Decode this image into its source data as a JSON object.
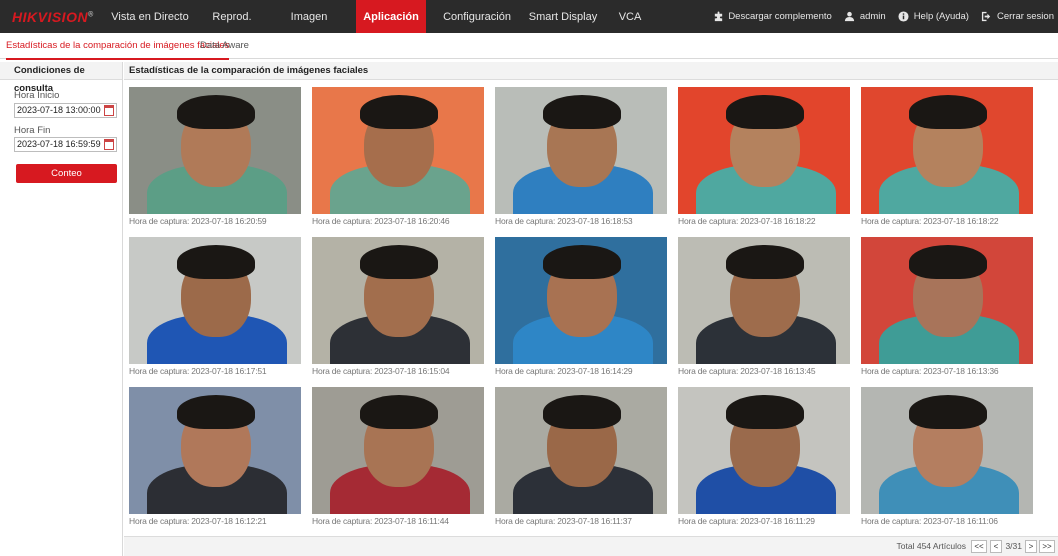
{
  "brand": {
    "logo": "HIKVISION",
    "reg": "®"
  },
  "nav": [
    {
      "label": "Vista en Directo"
    },
    {
      "label": "Reprod."
    },
    {
      "label": "Imagen"
    },
    {
      "label": "Aplicación",
      "active": true
    },
    {
      "label": "Configuración"
    },
    {
      "label": "Smart Display"
    },
    {
      "label": "VCA"
    }
  ],
  "topright": {
    "download": "Descargar complemento",
    "user": "admin",
    "help": "Help (Ayuda)",
    "logout": "Cerrar sesion"
  },
  "subtabs": [
    {
      "label": "Estadísticas de la comparación de imágenes faciales",
      "active": true
    },
    {
      "label": "Data Aware"
    }
  ],
  "query": {
    "title": "Condiciones de consulta",
    "start_label": "Hora Inicio",
    "start_value": "2023-07-18 13:00:00",
    "end_label": "Hora Fin",
    "end_value": "2023-07-18 16:59:59",
    "button": "Conteo"
  },
  "results": {
    "title": "Estadísticas de la comparación de imágenes faciales",
    "items": [
      {
        "caption": "Hora de captura: 2023-07-18 16:20:59",
        "palette": {
          "bg": "#8a8e86",
          "face": "#b07a58",
          "shirt": "#5c9e86"
        }
      },
      {
        "caption": "Hora de captura: 2023-07-18 16:20:46",
        "palette": {
          "bg": "#e8774a",
          "face": "#a66e4c",
          "shirt": "#6aa38d"
        }
      },
      {
        "caption": "Hora de captura: 2023-07-18 16:18:53",
        "palette": {
          "bg": "#b9bdb8",
          "face": "#a87654",
          "shirt": "#2f7fc0"
        }
      },
      {
        "caption": "Hora de captura: 2023-07-18 16:18:22",
        "palette": {
          "bg": "#e2452c",
          "face": "#b4825e",
          "shirt": "#4fa8a0"
        }
      },
      {
        "caption": "Hora de captura: 2023-07-18 16:18:22",
        "palette": {
          "bg": "#e0472e",
          "face": "#b4825e",
          "shirt": "#4fa8a0"
        }
      },
      {
        "caption": "Hora de captura: 2023-07-18 16:17:51",
        "palette": {
          "bg": "#c7c9c6",
          "face": "#9c6a4a",
          "shirt": "#1f56b4"
        }
      },
      {
        "caption": "Hora de captura: 2023-07-18 16:15:04",
        "palette": {
          "bg": "#b4b2a6",
          "face": "#a26e4d",
          "shirt": "#2d3036"
        }
      },
      {
        "caption": "Hora de captura: 2023-07-18 16:14:29",
        "palette": {
          "bg": "#2f6f9e",
          "face": "#a87252",
          "shirt": "#2e86c6"
        }
      },
      {
        "caption": "Hora de captura: 2023-07-18 16:13:45",
        "palette": {
          "bg": "#bcbcb4",
          "face": "#9e6c4c",
          "shirt": "#2c3138"
        }
      },
      {
        "caption": "Hora de captura: 2023-07-18 16:13:36",
        "palette": {
          "bg": "#d2463a",
          "face": "#a8745a",
          "shirt": "#3f9c96"
        }
      },
      {
        "caption": "Hora de captura: 2023-07-18 16:12:21",
        "palette": {
          "bg": "#7f8fa8",
          "face": "#b0785a",
          "shirt": "#2c2e34"
        }
      },
      {
        "caption": "Hora de captura: 2023-07-18 16:11:44",
        "palette": {
          "bg": "#9e9c94",
          "face": "#a87454",
          "shirt": "#a52a34"
        }
      },
      {
        "caption": "Hora de captura: 2023-07-18 16:11:37",
        "palette": {
          "bg": "#aaaaa2",
          "face": "#9a6848",
          "shirt": "#2c3038"
        }
      },
      {
        "caption": "Hora de captura: 2023-07-18 16:11:29",
        "palette": {
          "bg": "#c4c4bf",
          "face": "#9a6a4c",
          "shirt": "#1f4fa6"
        }
      },
      {
        "caption": "Hora de captura: 2023-07-18 16:11:06",
        "palette": {
          "bg": "#b4b6b2",
          "face": "#b47e60",
          "shirt": "#3f8fb8"
        }
      }
    ]
  },
  "pagination": {
    "total": "Total 454 Artículos",
    "first": "<<",
    "prev": "<",
    "page": "3/31",
    "next": ">",
    "last": ">>"
  }
}
